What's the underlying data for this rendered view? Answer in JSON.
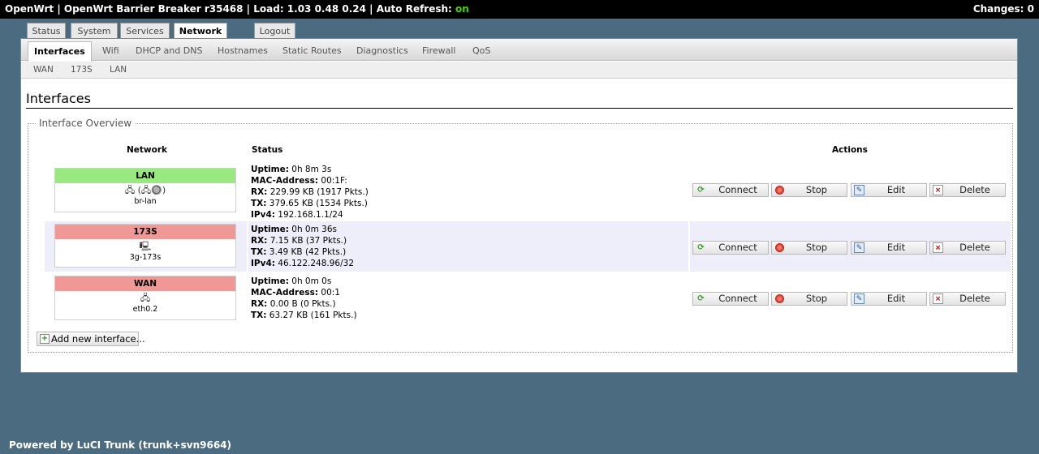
{
  "topbar": {
    "title": "OpenWrt | OpenWrt Barrier Breaker r35468 | Load: 1.03 0.48 0.24 | Auto Refresh: ",
    "auto_refresh": "on",
    "changes": "Changes: 0"
  },
  "main_tabs": [
    "Status",
    "System",
    "Services",
    "Network",
    "Logout"
  ],
  "subnav": [
    "Interfaces",
    "Wifi",
    "DHCP and DNS",
    "Hostnames",
    "Static Routes",
    "Diagnostics",
    "Firewall",
    "QoS"
  ],
  "subsubnav": [
    "WAN",
    "173S",
    "LAN"
  ],
  "page_title": "Interfaces",
  "fieldset_legend": "Interface Overview",
  "columns": {
    "network": "Network",
    "status": "Status",
    "actions": "Actions"
  },
  "rows": [
    {
      "name": "LAN",
      "icons": "🖧 (🖧🔘)",
      "device": "br-lan",
      "status": [
        {
          "k": "Uptime:",
          "v": " 0h 8m 3s"
        },
        {
          "k": "MAC-Address:",
          "v": " 00:1F:"
        },
        {
          "k": "RX:",
          "v": " 229.99 KB (1917 Pkts.)"
        },
        {
          "k": "TX:",
          "v": " 379.65 KB (1534 Pkts.)"
        },
        {
          "k": "IPv4:",
          "v": " 192.168.1.1/24"
        }
      ]
    },
    {
      "name": "173S",
      "icons": "🖳",
      "device": "3g-173s",
      "status": [
        {
          "k": "Uptime:",
          "v": " 0h 0m 36s"
        },
        {
          "k": "RX:",
          "v": " 7.15 KB (37 Pkts.)"
        },
        {
          "k": "TX:",
          "v": " 3.49 KB (42 Pkts.)"
        },
        {
          "k": "IPv4:",
          "v": " 46.122.248.96/32"
        }
      ]
    },
    {
      "name": "WAN",
      "icons": "🖧",
      "device": "eth0.2",
      "status": [
        {
          "k": "Uptime:",
          "v": " 0h 0m 0s"
        },
        {
          "k": "MAC-Address:",
          "v": " 00:1"
        },
        {
          "k": "RX:",
          "v": " 0.00 B (0 Pkts.)"
        },
        {
          "k": "TX:",
          "v": " 63.27 KB (161 Pkts.)"
        }
      ]
    }
  ],
  "actions": {
    "connect": "Connect",
    "stop": "Stop",
    "edit": "Edit",
    "delete": "Delete"
  },
  "add_interface": "Add new interface...",
  "footer": "Powered by LuCI Trunk (trunk+svn9664)",
  "colors": {
    "up": "#98ea80",
    "down": "#f09896",
    "background": "#4a6b80",
    "auto_refresh_on": "#44d400"
  }
}
